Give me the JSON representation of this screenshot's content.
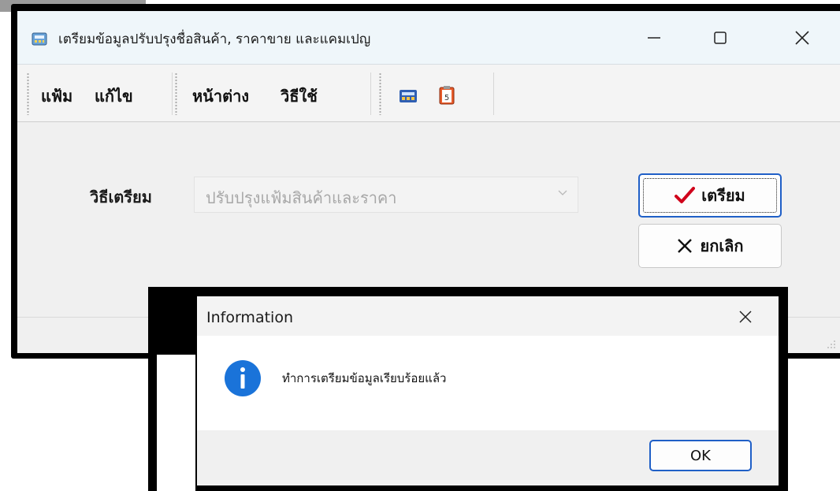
{
  "window": {
    "title": "เตรียมข้อมูลปรับปรุงชื่อสินค้า, ราคาขาย และแคมเปญ",
    "icon": "app-calculator-icon"
  },
  "menu": {
    "items": [
      {
        "label": "แฟ้ม"
      },
      {
        "label": "แก้ไข"
      },
      {
        "label": "หน้าต่าง"
      },
      {
        "label": "วิธีใช้"
      }
    ],
    "toolbar_icons": [
      "calculator-icon",
      "clipboard-icon"
    ]
  },
  "form": {
    "method_label": "วิธีเตรียม",
    "method_value": "ปรับปรุงแฟ้มสินค้าและราคา"
  },
  "buttons": {
    "prepare": "เตรียม",
    "cancel": "ยกเลิก"
  },
  "dialog": {
    "title": "Information",
    "message": "ทำการเตรียมข้อมูลเรียบร้อยแล้ว",
    "ok": "OK",
    "icon": "info-icon"
  },
  "colors": {
    "accent": "#1f5fc7",
    "check": "#d0021b",
    "info": "#1a73d9"
  }
}
